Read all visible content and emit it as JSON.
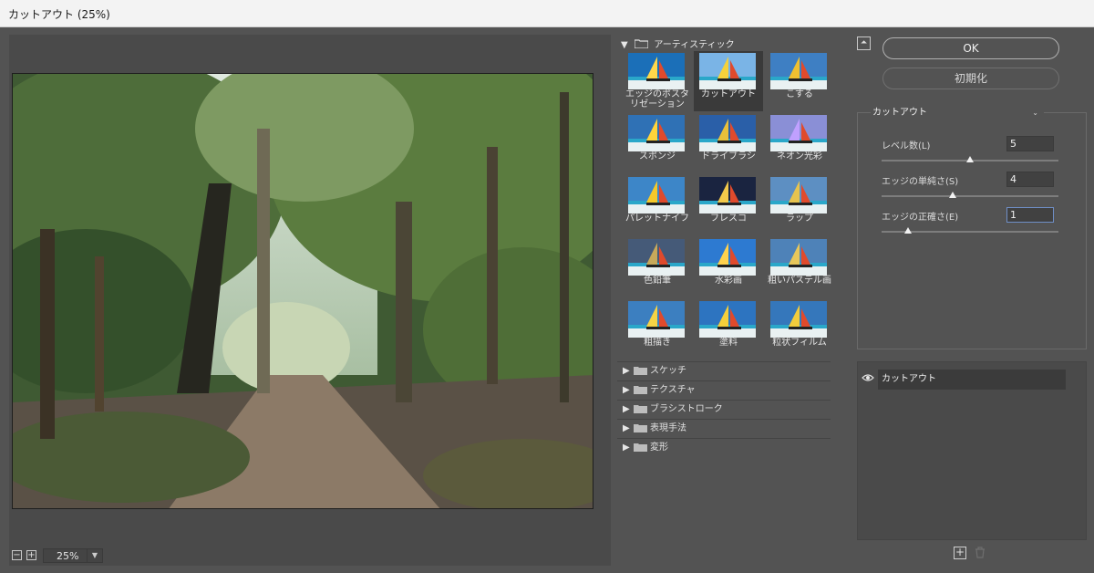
{
  "window": {
    "title": "カットアウト (25%)"
  },
  "preview": {
    "zoom_label": "25%",
    "zoom_out_icon": "minus-square-icon",
    "zoom_in_icon": "plus-square-icon"
  },
  "gallery": {
    "expanded_category": "アーティスティック",
    "filters": [
      {
        "label": "エッジのポスタリゼーション",
        "selected": false
      },
      {
        "label": "カットアウト",
        "selected": true
      },
      {
        "label": "こする",
        "selected": false
      },
      {
        "label": "スポンジ",
        "selected": false
      },
      {
        "label": "ドライブラシ",
        "selected": false
      },
      {
        "label": "ネオン光彩",
        "selected": false
      },
      {
        "label": "パレットナイフ",
        "selected": false
      },
      {
        "label": "フレスコ",
        "selected": false
      },
      {
        "label": "ラップ",
        "selected": false
      },
      {
        "label": "色鉛筆",
        "selected": false
      },
      {
        "label": "水彩画",
        "selected": false
      },
      {
        "label": "粗いパステル画",
        "selected": false
      },
      {
        "label": "粗描き",
        "selected": false
      },
      {
        "label": "塗料",
        "selected": false
      },
      {
        "label": "粒状フィルム",
        "selected": false
      }
    ],
    "collapsed_categories": [
      "スケッチ",
      "テクスチャ",
      "ブラシストローク",
      "表現手法",
      "変形"
    ]
  },
  "panel": {
    "ok_label": "OK",
    "reset_label": "初期化",
    "filter_select": "カットアウト",
    "params": [
      {
        "label": "レベル数(L)",
        "value": "5",
        "slider_fraction": 0.5,
        "focused": false
      },
      {
        "label": "エッジの単純さ(S)",
        "value": "4",
        "slider_fraction": 0.4,
        "focused": false
      },
      {
        "label": "エッジの正確さ(E)",
        "value": "1",
        "slider_fraction": 0.15,
        "focused": true
      }
    ],
    "layers": [
      {
        "label": "カットアウト",
        "visible": true
      }
    ]
  },
  "colors": {
    "background": "#535353",
    "selected_thumb": "#3a3a3a",
    "focus_border": "#6f8fc7"
  }
}
